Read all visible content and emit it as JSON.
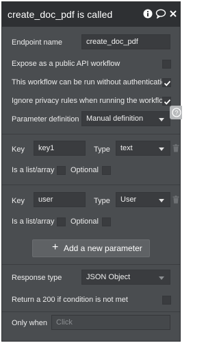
{
  "window": {
    "title": "create_doc_pdf is called",
    "icons": [
      "info-icon",
      "comment-icon",
      "close-icon"
    ]
  },
  "endpoint": {
    "label": "Endpoint name",
    "value": "create_doc_pdf"
  },
  "options": [
    {
      "label": "Expose as a public API workflow",
      "checked": false
    },
    {
      "label": "This workflow can be run without authentication",
      "checked": true
    },
    {
      "label": "Ignore privacy rules when running the workflow",
      "checked": true
    }
  ],
  "param_definition": {
    "label": "Parameter definition",
    "value": "Manual definition"
  },
  "parameters": [
    {
      "key_label": "Key",
      "key": "key1",
      "type_label": "Type",
      "type": "text",
      "list_label": "Is a list/array",
      "optional_label": "Optional"
    },
    {
      "key_label": "Key",
      "key": "user",
      "type_label": "Type",
      "type": "User",
      "list_label": "Is a list/array",
      "optional_label": "Optional"
    }
  ],
  "add_parameter": {
    "label": "Add a new parameter"
  },
  "response": {
    "label": "Response type",
    "value": "JSON Object"
  },
  "return_200": {
    "label": "Return a 200 if condition is not met",
    "checked": false
  },
  "only_when": {
    "label": "Only when",
    "placeholder": "Click"
  },
  "colors": {
    "panel": "#4a4d50",
    "titlebar": "#2e3033",
    "field": "#3a3c3f",
    "button": "#5f6265"
  }
}
